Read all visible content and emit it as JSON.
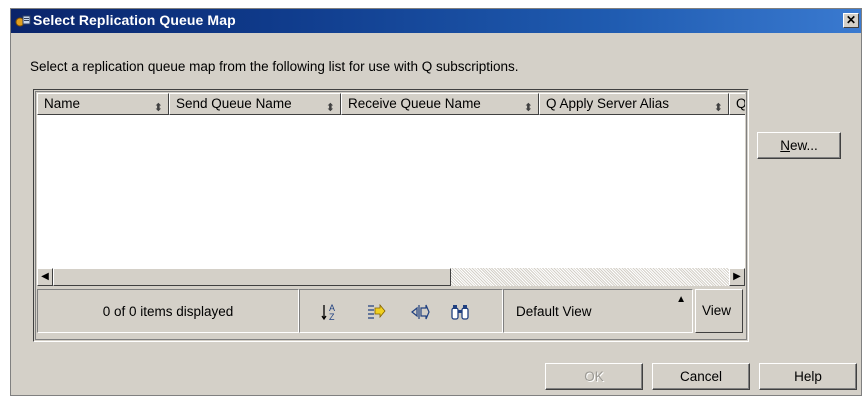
{
  "window": {
    "title": "Select Replication Queue Map",
    "close_label": "✕"
  },
  "instruction": "Select a replication queue map from the following list for use with Q subscriptions.",
  "grid": {
    "columns": [
      "Name",
      "Send Queue Name",
      "Receive Queue Name",
      "Q Apply Server Alias",
      "Q"
    ],
    "rows": []
  },
  "status": {
    "items_displayed": "0 of 0 items displayed",
    "toolbar_icons": [
      "sort-icon",
      "filter-icon",
      "columns-icon",
      "find-icon"
    ],
    "view_selected": "Default View",
    "view_button_label": "View"
  },
  "buttons": {
    "new_label_underlined": "N",
    "new_label_rest": "ew...",
    "ok_label": "OK",
    "cancel_label": "Cancel",
    "help_label": "Help"
  }
}
